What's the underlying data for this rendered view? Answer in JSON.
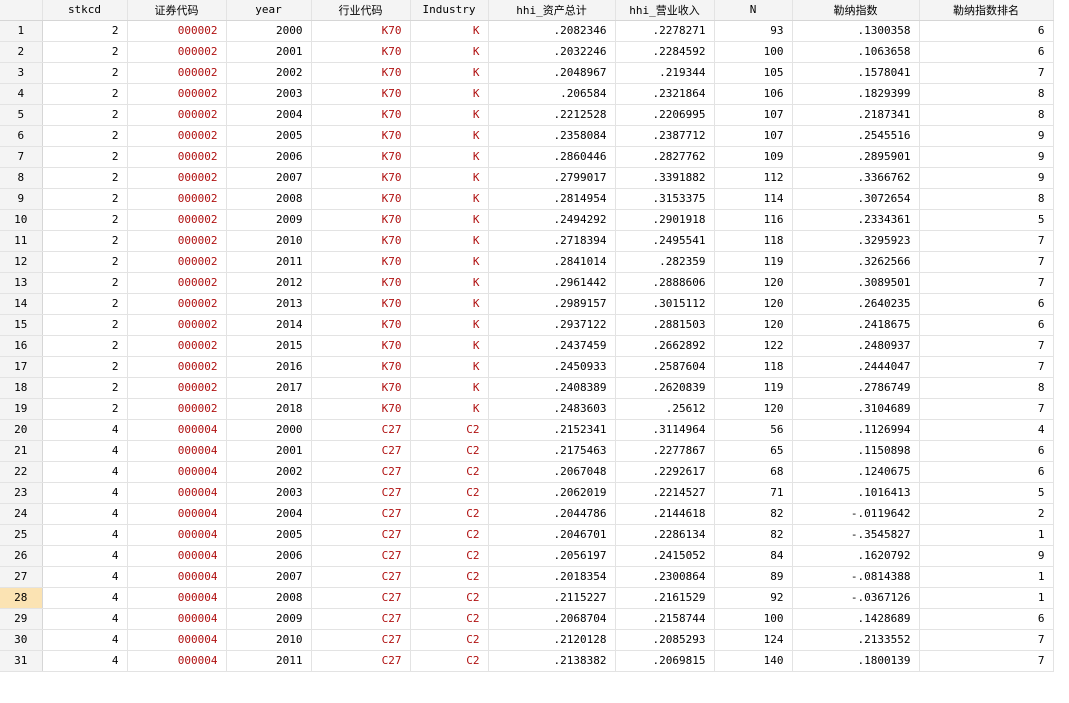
{
  "columns": [
    "",
    "stkcd",
    "证券代码",
    "year",
    "行业代码",
    "Industry",
    "hhi_资产总计",
    "hhi_营业收入",
    "N",
    "勒纳指数",
    "勒纳指数排名"
  ],
  "selected_row": 28,
  "rows": [
    [
      "1",
      "2",
      "000002",
      "2000",
      "K70",
      "K",
      ".2082346",
      ".2278271",
      "93",
      ".1300358",
      "6"
    ],
    [
      "2",
      "2",
      "000002",
      "2001",
      "K70",
      "K",
      ".2032246",
      ".2284592",
      "100",
      ".1063658",
      "6"
    ],
    [
      "3",
      "2",
      "000002",
      "2002",
      "K70",
      "K",
      ".2048967",
      ".219344",
      "105",
      ".1578041",
      "7"
    ],
    [
      "4",
      "2",
      "000002",
      "2003",
      "K70",
      "K",
      ".206584",
      ".2321864",
      "106",
      ".1829399",
      "8"
    ],
    [
      "5",
      "2",
      "000002",
      "2004",
      "K70",
      "K",
      ".2212528",
      ".2206995",
      "107",
      ".2187341",
      "8"
    ],
    [
      "6",
      "2",
      "000002",
      "2005",
      "K70",
      "K",
      ".2358084",
      ".2387712",
      "107",
      ".2545516",
      "9"
    ],
    [
      "7",
      "2",
      "000002",
      "2006",
      "K70",
      "K",
      ".2860446",
      ".2827762",
      "109",
      ".2895901",
      "9"
    ],
    [
      "8",
      "2",
      "000002",
      "2007",
      "K70",
      "K",
      ".2799017",
      ".3391882",
      "112",
      ".3366762",
      "9"
    ],
    [
      "9",
      "2",
      "000002",
      "2008",
      "K70",
      "K",
      ".2814954",
      ".3153375",
      "114",
      ".3072654",
      "8"
    ],
    [
      "10",
      "2",
      "000002",
      "2009",
      "K70",
      "K",
      ".2494292",
      ".2901918",
      "116",
      ".2334361",
      "5"
    ],
    [
      "11",
      "2",
      "000002",
      "2010",
      "K70",
      "K",
      ".2718394",
      ".2495541",
      "118",
      ".3295923",
      "7"
    ],
    [
      "12",
      "2",
      "000002",
      "2011",
      "K70",
      "K",
      ".2841014",
      ".282359",
      "119",
      ".3262566",
      "7"
    ],
    [
      "13",
      "2",
      "000002",
      "2012",
      "K70",
      "K",
      ".2961442",
      ".2888606",
      "120",
      ".3089501",
      "7"
    ],
    [
      "14",
      "2",
      "000002",
      "2013",
      "K70",
      "K",
      ".2989157",
      ".3015112",
      "120",
      ".2640235",
      "6"
    ],
    [
      "15",
      "2",
      "000002",
      "2014",
      "K70",
      "K",
      ".2937122",
      ".2881503",
      "120",
      ".2418675",
      "6"
    ],
    [
      "16",
      "2",
      "000002",
      "2015",
      "K70",
      "K",
      ".2437459",
      ".2662892",
      "122",
      ".2480937",
      "7"
    ],
    [
      "17",
      "2",
      "000002",
      "2016",
      "K70",
      "K",
      ".2450933",
      ".2587604",
      "118",
      ".2444047",
      "7"
    ],
    [
      "18",
      "2",
      "000002",
      "2017",
      "K70",
      "K",
      ".2408389",
      ".2620839",
      "119",
      ".2786749",
      "8"
    ],
    [
      "19",
      "2",
      "000002",
      "2018",
      "K70",
      "K",
      ".2483603",
      ".25612",
      "120",
      ".3104689",
      "7"
    ],
    [
      "20",
      "4",
      "000004",
      "2000",
      "C27",
      "C2",
      ".2152341",
      ".3114964",
      "56",
      ".1126994",
      "4"
    ],
    [
      "21",
      "4",
      "000004",
      "2001",
      "C27",
      "C2",
      ".2175463",
      ".2277867",
      "65",
      ".1150898",
      "6"
    ],
    [
      "22",
      "4",
      "000004",
      "2002",
      "C27",
      "C2",
      ".2067048",
      ".2292617",
      "68",
      ".1240675",
      "6"
    ],
    [
      "23",
      "4",
      "000004",
      "2003",
      "C27",
      "C2",
      ".2062019",
      ".2214527",
      "71",
      ".1016413",
      "5"
    ],
    [
      "24",
      "4",
      "000004",
      "2004",
      "C27",
      "C2",
      ".2044786",
      ".2144618",
      "82",
      "-.0119642",
      "2"
    ],
    [
      "25",
      "4",
      "000004",
      "2005",
      "C27",
      "C2",
      ".2046701",
      ".2286134",
      "82",
      "-.3545827",
      "1"
    ],
    [
      "26",
      "4",
      "000004",
      "2006",
      "C27",
      "C2",
      ".2056197",
      ".2415052",
      "84",
      ".1620792",
      "9"
    ],
    [
      "27",
      "4",
      "000004",
      "2007",
      "C27",
      "C2",
      ".2018354",
      ".2300864",
      "89",
      "-.0814388",
      "1"
    ],
    [
      "28",
      "4",
      "000004",
      "2008",
      "C27",
      "C2",
      ".2115227",
      ".2161529",
      "92",
      "-.0367126",
      "1"
    ],
    [
      "29",
      "4",
      "000004",
      "2009",
      "C27",
      "C2",
      ".2068704",
      ".2158744",
      "100",
      ".1428689",
      "6"
    ],
    [
      "30",
      "4",
      "000004",
      "2010",
      "C27",
      "C2",
      ".2120128",
      ".2085293",
      "124",
      ".2133552",
      "7"
    ],
    [
      "31",
      "4",
      "000004",
      "2011",
      "C27",
      "C2",
      ".2138382",
      ".2069815",
      "140",
      ".1800139",
      "7"
    ]
  ]
}
